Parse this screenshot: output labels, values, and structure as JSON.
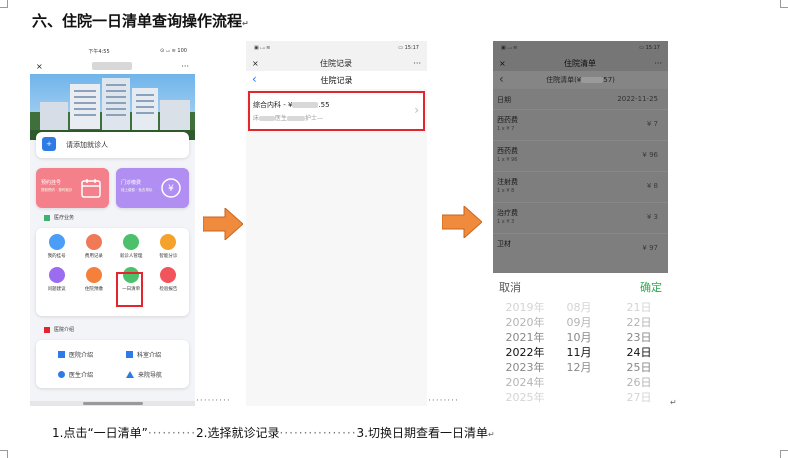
{
  "heading": "六、住院一日清单查询操作流程",
  "para_mark": "↵",
  "phone1": {
    "time": "下午4:55",
    "signal": "⊙ ᵢ.ᵢᵢ ≋ 100",
    "close": "×",
    "more": "···",
    "add_patient": "请添加就诊人",
    "add_btn": "+",
    "quick": [
      {
        "label": "预约挂号",
        "sub": "提前预约 · 按时就诊",
        "color": "#f36d76"
      },
      {
        "label": "门诊缴费",
        "sub": "线上缴费 · 免去排队",
        "color": "#a781f0"
      }
    ],
    "section_services": "医疗业务",
    "services": [
      {
        "label": "我的挂号",
        "color": "#4a9ef8"
      },
      {
        "label": "费用记录",
        "color": "#f07a58"
      },
      {
        "label": "就诊人管理",
        "color": "#4cc06a"
      },
      {
        "label": "智能分诊",
        "color": "#f4a22c"
      },
      {
        "label": "问题建议",
        "color": "#9b6cf0"
      },
      {
        "label": "住院预缴",
        "color": "#f5803b"
      },
      {
        "label": "一日清单",
        "color": "#4cc06a"
      },
      {
        "label": "检验报告",
        "color": "#f2545b"
      }
    ],
    "section_intro": "医院介绍",
    "intro": [
      {
        "label": "医院介绍",
        "icon": "building-icon"
      },
      {
        "label": "科室介绍",
        "icon": "department-icon"
      },
      {
        "label": "医生介绍",
        "icon": "doctor-icon"
      },
      {
        "label": "来院导航",
        "icon": "navigate-icon"
      }
    ]
  },
  "phone2": {
    "signal": "▣ ᵢ.ᵢᵢ ≋",
    "battery": "▭ 15:17",
    "close": "×",
    "title": "住院记录",
    "more": "···",
    "back": "‹",
    "subtitle": "住院记录",
    "record_title": "综合内科 - ¥",
    "record_amount": ".55",
    "record_sub": "床",
    "record_sub2": "医生",
    "record_sub3": "护士—",
    "chevron": "›"
  },
  "phone3": {
    "signal": "▣ ᵢ.ᵢᵢ ≋",
    "battery": "▭ 15:17",
    "close": "×",
    "title": "住院清单",
    "more": "···",
    "back": "‹",
    "subtitle": "住院清单(¥",
    "subtitle_tail": "57)",
    "date_label": "日期",
    "date_value": "2022-11-25",
    "items": [
      {
        "name": "西药费",
        "sub": "1 x ¥ 7",
        "amount": "¥ 7"
      },
      {
        "name": "西药费",
        "sub": "1 x ¥ 96",
        "amount": "¥ 96"
      },
      {
        "name": "注射费",
        "sub": "1 x ¥ 8",
        "amount": "¥ 8"
      },
      {
        "name": "治疗费",
        "sub": "1 x ¥ 3",
        "amount": "¥ 3"
      },
      {
        "name": "卫材",
        "sub": "",
        "amount": "¥ 97"
      }
    ],
    "cancel": "取消",
    "confirm": "确定",
    "years": [
      "2019年",
      "2020年",
      "2021年",
      "2022年",
      "2023年",
      "2024年",
      "2025年"
    ],
    "months": [
      "08月",
      "09月",
      "10月",
      "11月",
      "12月"
    ],
    "days": [
      "21日",
      "22日",
      "23日",
      "24日",
      "25日",
      "26日",
      "27日"
    ]
  },
  "captions": {
    "step1": "1.点击“一日清单”",
    "dots1": "··········",
    "step2": "2.选择就诊记录",
    "dots2": "················",
    "step3": "3.切换日期查看一日清单",
    "mark": "↵"
  },
  "colors": {
    "accent_green": "#2fa84f",
    "arrow": "#f08a3c",
    "highlight": "#e3262d"
  }
}
